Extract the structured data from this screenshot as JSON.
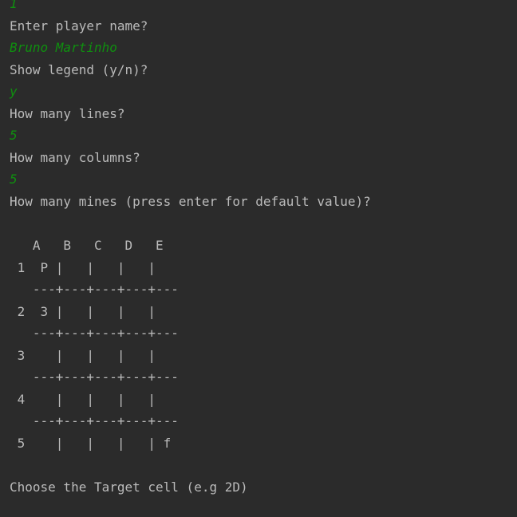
{
  "console": {
    "lines": [
      {
        "text": "1",
        "kind": "input"
      },
      {
        "text": "Enter player name?",
        "kind": "prompt"
      },
      {
        "text": "Bruno Martinho",
        "kind": "input"
      },
      {
        "text": "Show legend (y/n)?",
        "kind": "prompt"
      },
      {
        "text": "y",
        "kind": "input"
      },
      {
        "text": "How many lines?",
        "kind": "prompt"
      },
      {
        "text": "5",
        "kind": "input"
      },
      {
        "text": "How many columns?",
        "kind": "prompt"
      },
      {
        "text": "5",
        "kind": "input"
      },
      {
        "text": "How many mines (press enter for default value)?",
        "kind": "prompt"
      }
    ],
    "board": {
      "header": "   A   B   C   D   E",
      "rows": [
        " 1  P |   |   |   |",
        "   ---+---+---+---+---",
        " 2  3 |   |   |   |",
        "   ---+---+---+---+---",
        " 3    |   |   |   |",
        "   ---+---+---+---+---",
        " 4    |   |   |   |",
        "   ---+---+---+---+---",
        " 5    |   |   |   | f"
      ]
    },
    "final_prompt": "Choose the Target cell (e.g 2D)"
  },
  "colors": {
    "background": "#2b2b2b",
    "prompt_text": "#bbbbbb",
    "user_input": "#0f8f0f"
  }
}
